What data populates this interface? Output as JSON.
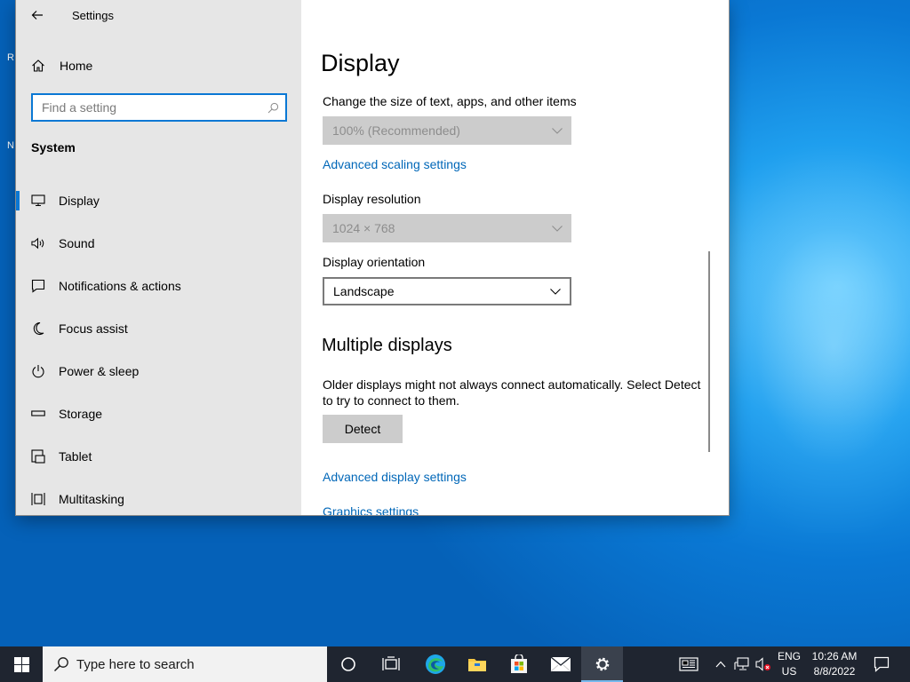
{
  "window": {
    "title": "Settings"
  },
  "nav": {
    "home_label": "Home",
    "search_placeholder": "Find a setting",
    "section_label": "System",
    "items": [
      {
        "label": "Display",
        "icon": "monitor-icon",
        "active": true
      },
      {
        "label": "Sound",
        "icon": "speaker-icon"
      },
      {
        "label": "Notifications & actions",
        "icon": "notifications-icon"
      },
      {
        "label": "Focus assist",
        "icon": "moon-icon"
      },
      {
        "label": "Power & sleep",
        "icon": "power-icon"
      },
      {
        "label": "Storage",
        "icon": "storage-icon"
      },
      {
        "label": "Tablet",
        "icon": "tablet-icon"
      },
      {
        "label": "Multitasking",
        "icon": "multitasking-icon"
      }
    ]
  },
  "content": {
    "page_title": "Display",
    "scale_label": "Change the size of text, apps, and other items",
    "scale_value": "100% (Recommended)",
    "advanced_scaling_link": "Advanced scaling settings",
    "resolution_label": "Display resolution",
    "resolution_value": "1024 × 768",
    "orientation_label": "Display orientation",
    "orientation_value": "Landscape",
    "multiple_displays_heading": "Multiple displays",
    "multiple_displays_text": "Older displays might not always connect automatically. Select Detect to try to connect to them.",
    "detect_button": "Detect",
    "advanced_display_link": "Advanced display settings",
    "graphics_link": "Graphics settings"
  },
  "desktop": {
    "peek_top": "R",
    "peek_bottom": "N"
  },
  "taskbar": {
    "search_placeholder": "Type here to search",
    "apps": [
      "cortana-icon",
      "task-view-icon",
      "edge-icon",
      "file-explorer-icon",
      "store-icon",
      "mail-icon",
      "settings-icon"
    ],
    "lang_top": "ENG",
    "lang_bottom": "US",
    "time": "10:26 AM",
    "date": "8/8/2022"
  },
  "colors": {
    "accent": "#0a78d4",
    "link": "#0067b8",
    "nav_bg": "#e6e6e6",
    "taskbar_bg": "#1f2530"
  }
}
